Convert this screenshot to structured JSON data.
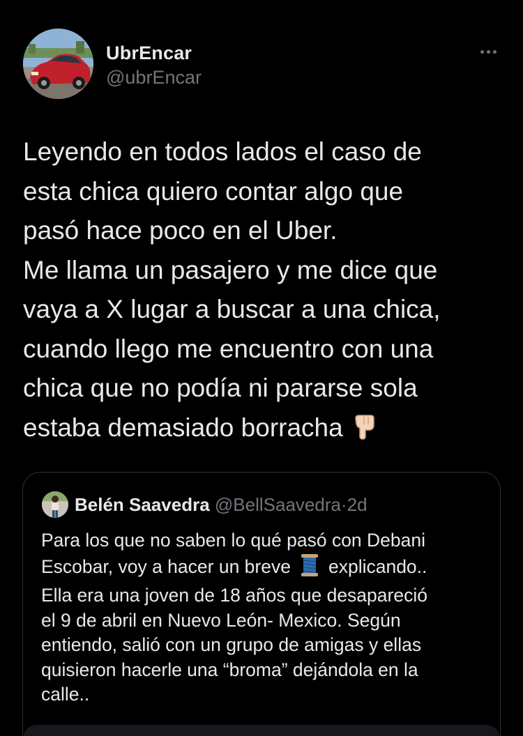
{
  "tweet": {
    "author": {
      "display_name": "UbrEncar",
      "handle": "@ubrEncar",
      "avatar_icon": "red-car-avatar"
    },
    "more_icon": "more-dots-icon",
    "text_lines": [
      "Leyendo en todos lados el caso de",
      "esta chica quiero contar algo que",
      "pasó hace poco en el Uber.",
      "Me llama un pasajero y me dice que",
      "vaya a X lugar a buscar a una chica,",
      "cuando llego me encuentro con una",
      "chica que no podía ni pararse sola",
      "estaba demasiado borracha"
    ],
    "trailing_emoji": "pointing-down-hand-emoji"
  },
  "quote": {
    "author": {
      "display_name": "Belén Saavedra",
      "handle": "@BellSaavedra",
      "separator": "·",
      "time": "2d"
    },
    "text_lines": [
      "Para los que no saben lo qué pasó con Debani",
      [
        "Escobar, voy a hacer un breve",
        "explicando.."
      ],
      "Ella era una joven de 18 años que desapareció",
      "el 9 de abril en Nuevo León- Mexico. Según",
      "entiendo, salió con un grupo de amigas y ellas",
      "quisieron hacerle una “broma” dejándola en la",
      "calle.."
    ],
    "inline_emoji": "thread-spool-emoji"
  },
  "colors": {
    "background": "#000000",
    "primary_text": "#e7e9ea",
    "secondary_text": "#71767b",
    "border": "#2f3336"
  }
}
